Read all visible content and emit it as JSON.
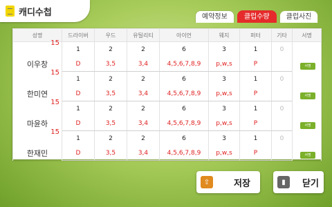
{
  "header": {
    "title": "캐디수첩"
  },
  "tabs": [
    {
      "label": "예약정보",
      "active": false
    },
    {
      "label": "클럽수량",
      "active": true
    },
    {
      "label": "클럽사진",
      "active": false
    }
  ],
  "columns": [
    "성명",
    "드라이버",
    "우드",
    "유틸리티",
    "아이언",
    "웨지",
    "퍼터",
    "기타",
    "서명"
  ],
  "players": [
    {
      "name": "이우창",
      "number": "15",
      "counts": [
        "1",
        "2",
        "2",
        "6",
        "3",
        "1",
        "0"
      ],
      "details": [
        "D",
        "3,5",
        "3,4",
        "4,5,6,7,8,9",
        "p,w,s",
        "P",
        ""
      ],
      "sign": "서명"
    },
    {
      "name": "한미연",
      "number": "15",
      "counts": [
        "1",
        "2",
        "2",
        "6",
        "3",
        "1",
        "0"
      ],
      "details": [
        "D",
        "3,5",
        "3,4",
        "4,5,6,7,8,9",
        "p,w,s",
        "P",
        ""
      ],
      "sign": "서명"
    },
    {
      "name": "마윤하",
      "number": "15",
      "counts": [
        "1",
        "2",
        "2",
        "6",
        "3",
        "1",
        "0"
      ],
      "details": [
        "D",
        "3,5",
        "3,4",
        "4,5,6,7,8,9",
        "p,w,s",
        "P",
        ""
      ],
      "sign": "서명"
    },
    {
      "name": "한재민",
      "number": "15",
      "counts": [
        "1",
        "2",
        "2",
        "6",
        "3",
        "1",
        "0"
      ],
      "details": [
        "D",
        "3,5",
        "3,4",
        "4,5,6,7,8,9",
        "p,w,s",
        "P",
        ""
      ],
      "sign": "서명"
    }
  ],
  "buttons": {
    "save": "저장",
    "close": "닫기"
  },
  "icons": {
    "title": "notebook-icon",
    "save": "upload-icon",
    "close": "exit-door-icon"
  },
  "colors": {
    "accent_red": "#e52b2b",
    "sign_green": "#7bb02a",
    "save_orange": "#e08a1f"
  }
}
